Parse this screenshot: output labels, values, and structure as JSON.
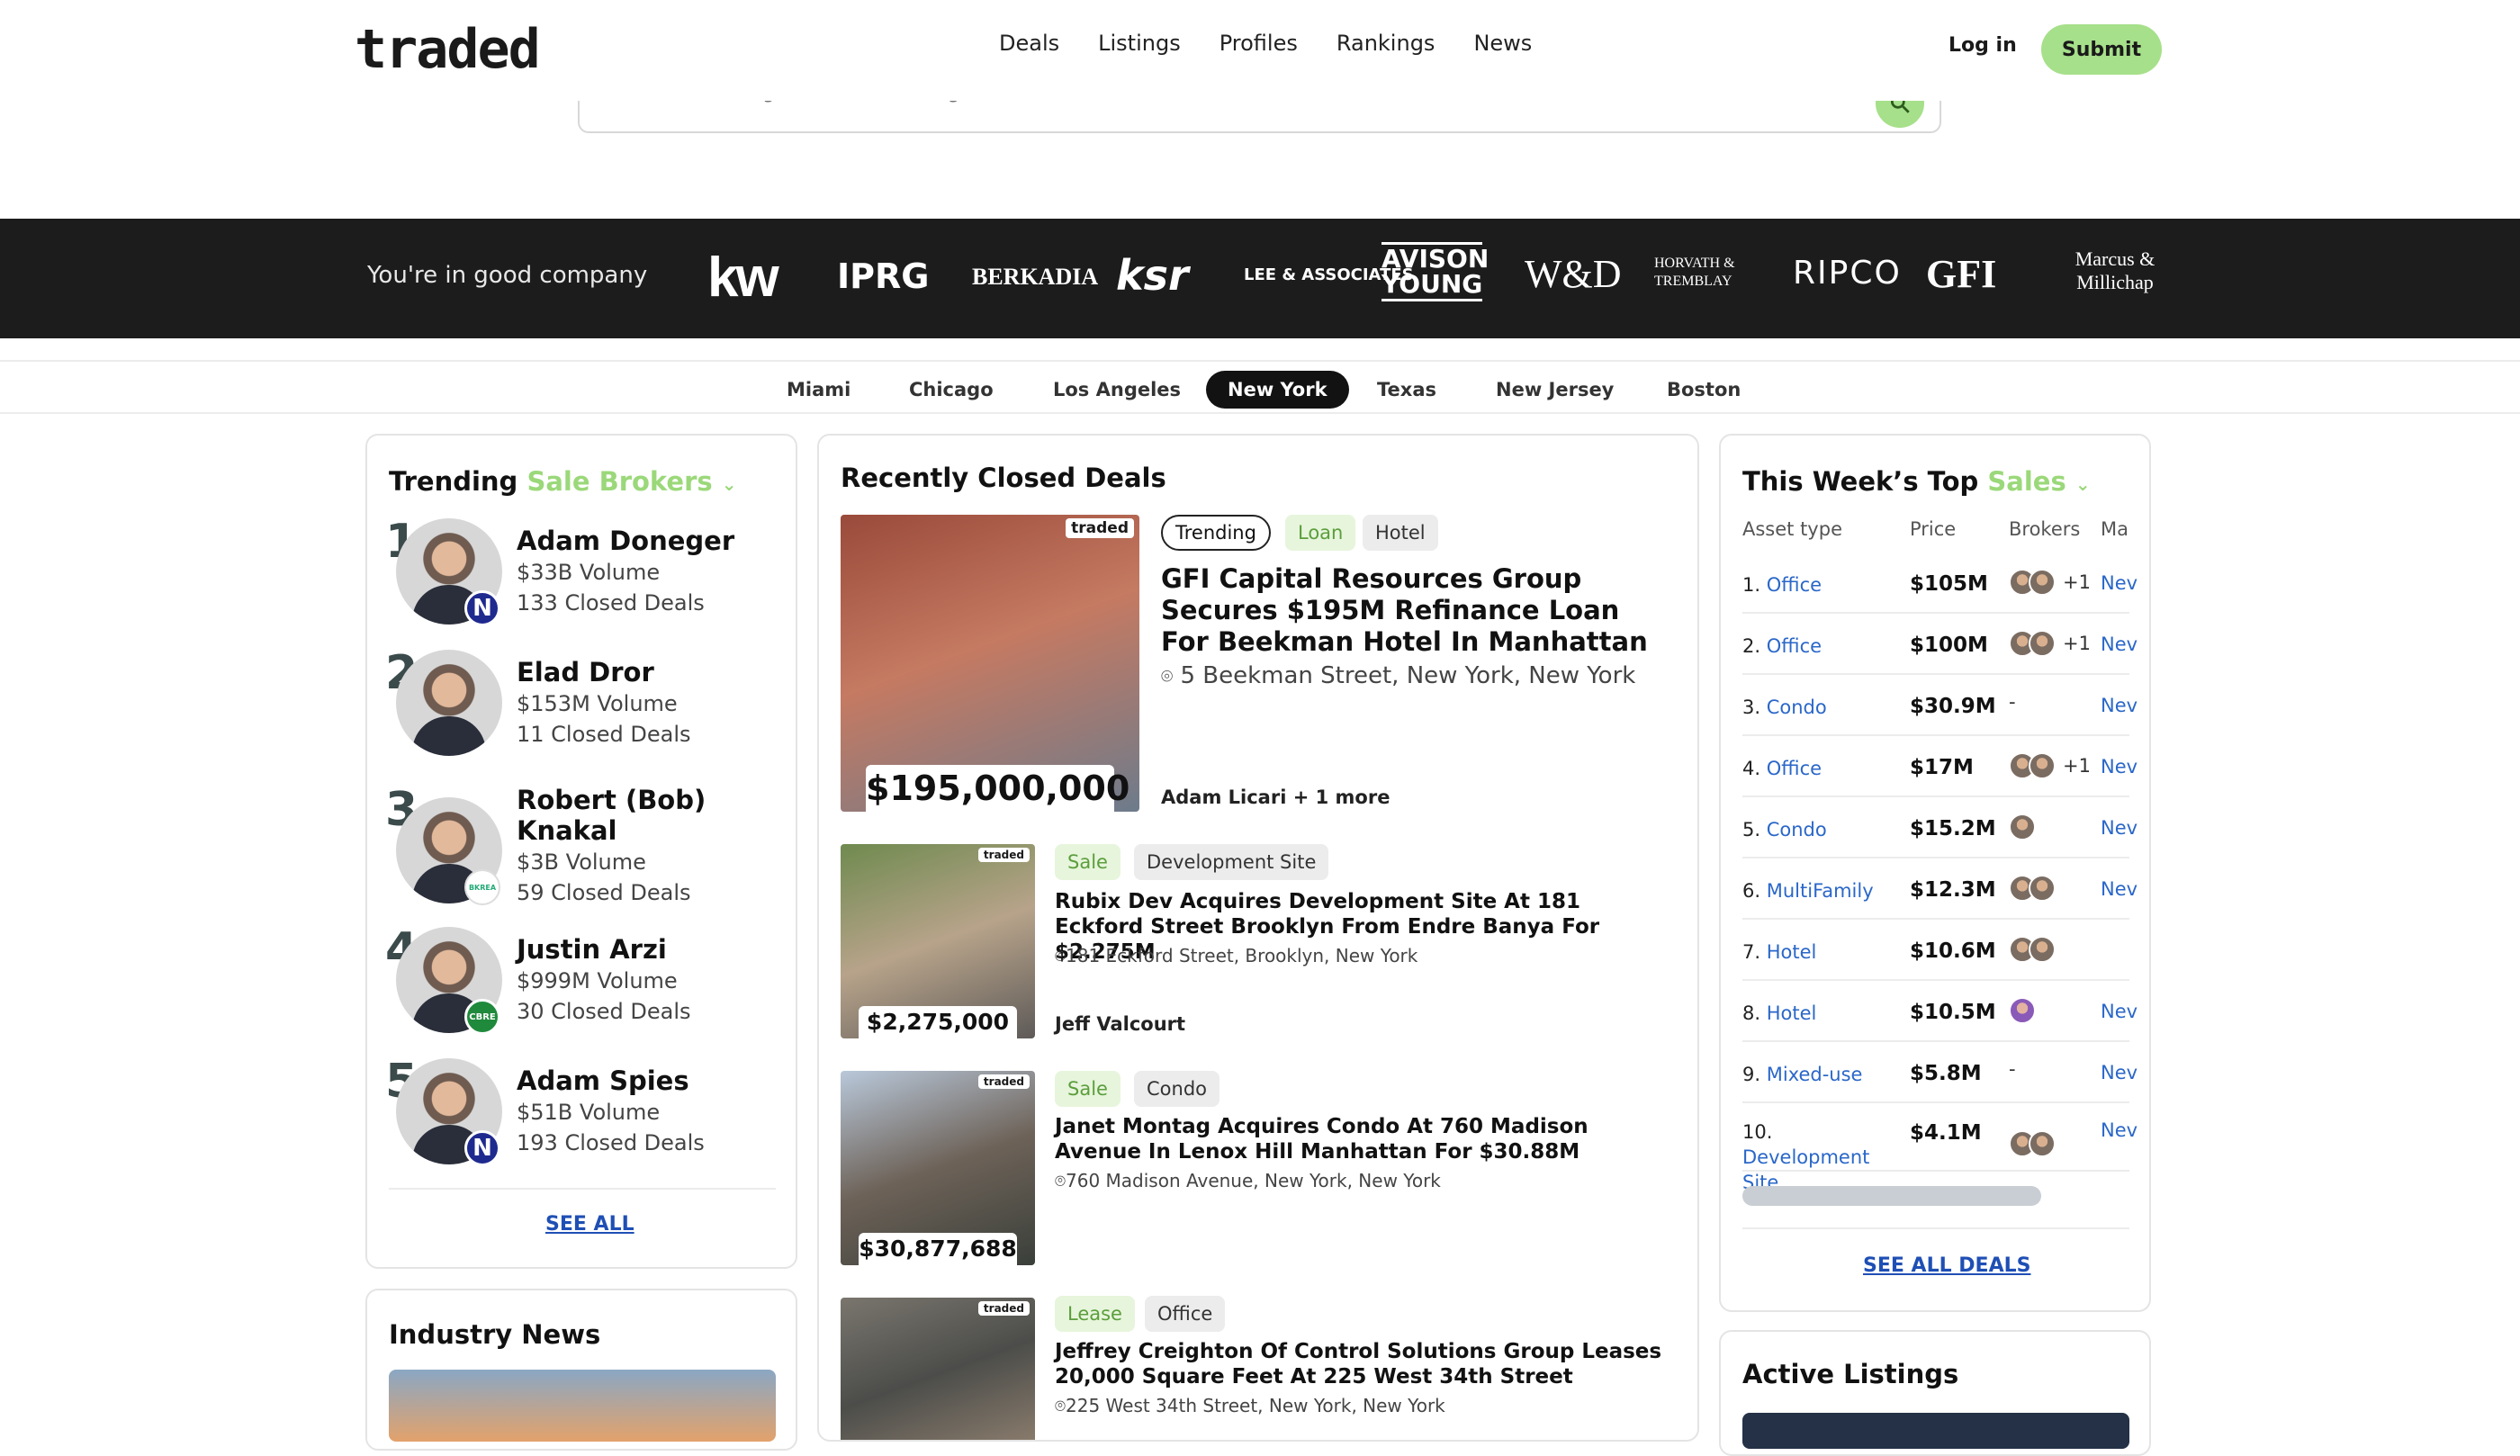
{
  "header": {
    "logo": "traded",
    "nav": [
      "Deals",
      "Listings",
      "Profiles",
      "Rankings",
      "News"
    ],
    "login": "Log in",
    "submit": "Submit",
    "search_placeholder": "Search Deals, Agents, Investors, Agencies, and Lenders"
  },
  "brands": {
    "label": "You're in good company",
    "items": [
      "kw",
      "IPRG",
      "BERKADIA",
      "ksr",
      "LEE & ASSOCIATES",
      "AVISON YOUNG",
      "W&D",
      "HORVATH & TREMBLAY",
      "RIPCO",
      "GFI",
      "Marcus & Millichap"
    ]
  },
  "cities": [
    "Miami",
    "Chicago",
    "Los Angeles",
    "New York",
    "Texas",
    "New Jersey",
    "Boston"
  ],
  "trending": {
    "title": "Trending",
    "filter": "Sale Brokers",
    "brokers": [
      {
        "rank": "1",
        "name": "Adam Doneger",
        "volume": "$33B Volume",
        "deals": "133 Closed Deals",
        "badge": "N"
      },
      {
        "rank": "2",
        "name": "Elad Dror",
        "volume": "$153M Volume",
        "deals": "11 Closed Deals",
        "badge": ""
      },
      {
        "rank": "3",
        "name": "Robert (Bob) Knakal",
        "volume": "$3B Volume",
        "deals": "59 Closed Deals",
        "badge": "BKREA"
      },
      {
        "rank": "4",
        "name": "Justin Arzi",
        "volume": "$999M Volume",
        "deals": "30 Closed Deals",
        "badge": "CBRE"
      },
      {
        "rank": "5",
        "name": "Adam Spies",
        "volume": "$51B Volume",
        "deals": "193 Closed Deals",
        "badge": "N"
      }
    ],
    "see_all": "SEE ALL"
  },
  "news": {
    "title": "Industry News"
  },
  "recent": {
    "title": "Recently Closed Deals",
    "deals": [
      {
        "price": "$195,000,000",
        "tags": [
          "Trending",
          "Loan",
          "Hotel"
        ],
        "title": "GFI Capital Resources Group Secures $195M Refinance Loan For Beekman Hotel In Manhattan",
        "address": "5 Beekman Street, New York, New York",
        "broker": "Adam Licari + 1 more"
      },
      {
        "price": "$2,275,000",
        "tags": [
          "Sale",
          "Development Site"
        ],
        "title": "Rubix Dev Acquires Development Site At 181 Eckford Street Brooklyn From Endre Banya For $2.275M",
        "address": "181 Eckford Street, Brooklyn, New York",
        "broker": "Jeff Valcourt"
      },
      {
        "price": "$30,877,688",
        "tags": [
          "Sale",
          "Condo"
        ],
        "title": "Janet Montag Acquires Condo At 760 Madison Avenue In Lenox Hill Manhattan For $30.88M",
        "address": "760 Madison Avenue, New York, New York",
        "broker": ""
      },
      {
        "price": "",
        "tags": [
          "Lease",
          "Office"
        ],
        "title": "Jeffrey Creighton Of Control Solutions Group Leases 20,000 Square Feet At 225 West 34th Street",
        "address": "225 West 34th Street, New York, New York",
        "broker": ""
      }
    ],
    "traded_tag": "traded"
  },
  "top": {
    "title": "This Week’s Top",
    "filter": "Sales",
    "columns": [
      "Asset type",
      "Price",
      "Brokers",
      "Ma"
    ],
    "rows": [
      {
        "num": "1.",
        "asset": "Office",
        "price": "$105M",
        "extra": "+1",
        "market": "Nev"
      },
      {
        "num": "2.",
        "asset": "Office",
        "price": "$100M",
        "extra": "+1",
        "market": "Nev"
      },
      {
        "num": "3.",
        "asset": "Condo",
        "price": "$30.9M",
        "extra": "-",
        "market": "Nev"
      },
      {
        "num": "4.",
        "asset": "Office",
        "price": "$17M",
        "extra": "+1",
        "market": "Nev"
      },
      {
        "num": "5.",
        "asset": "Condo",
        "price": "$15.2M",
        "extra": "",
        "market": "Nev"
      },
      {
        "num": "6.",
        "asset": "MultiFamily",
        "price": "$12.3M",
        "extra": "",
        "market": "Nev"
      },
      {
        "num": "7.",
        "asset": "Hotel",
        "price": "$10.6M",
        "extra": "",
        "market": ""
      },
      {
        "num": "8.",
        "asset": "Hotel",
        "price": "$10.5M",
        "extra": "",
        "market": "Nev"
      },
      {
        "num": "9.",
        "asset": "Mixed-use",
        "price": "$5.8M",
        "extra": "-",
        "market": "Nev"
      },
      {
        "num": "10.",
        "asset": "Development Site",
        "price": "$4.1M",
        "extra": "",
        "market": "Nev"
      }
    ],
    "see_all": "SEE ALL DEALS"
  },
  "listings": {
    "title": "Active Listings"
  }
}
